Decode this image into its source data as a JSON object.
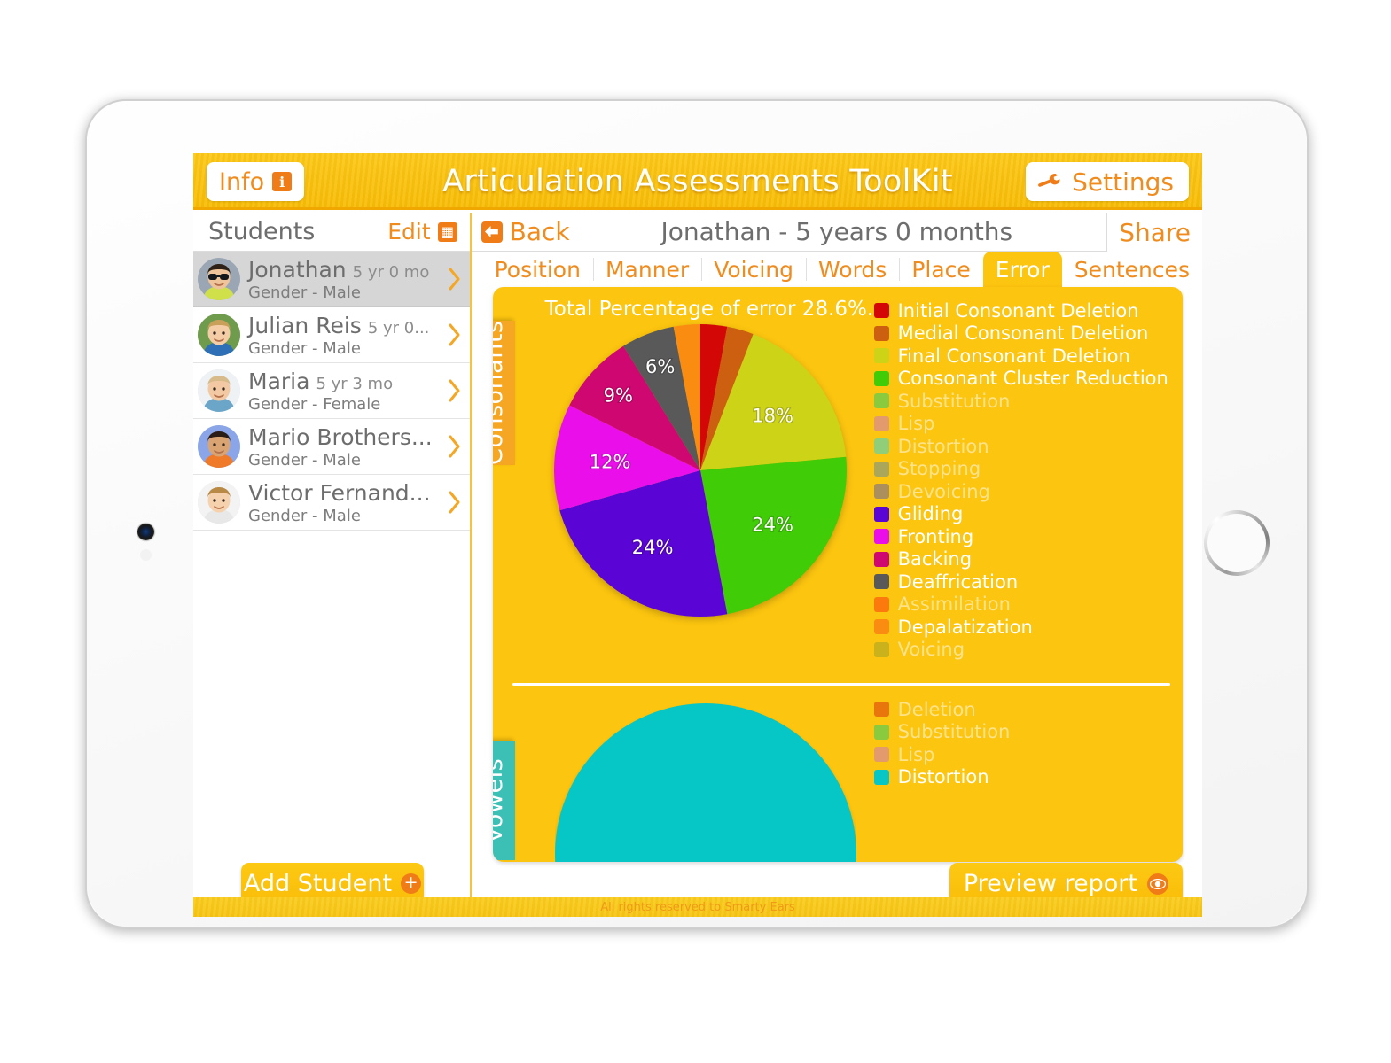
{
  "app": {
    "title": "Articulation Assessments ToolKit",
    "info_label": "Info",
    "info_badge": "i",
    "settings_label": "Settings",
    "footer": "All rights reserved to Smarty Ears",
    "accent_yellow": "#fcc50f",
    "accent_orange": "#f08c1e"
  },
  "sidebar": {
    "title": "Students",
    "edit_label": "Edit",
    "add_student_label": "Add Student",
    "students": [
      {
        "name": "Jonathan",
        "age": "5 yr 0 mo",
        "gender": "Gender - Male",
        "selected": true
      },
      {
        "name": "Julian Reis",
        "age": "5 yr 0...",
        "gender": "Gender - Male",
        "selected": false
      },
      {
        "name": "Maria",
        "age": "5 yr 3 mo",
        "gender": "Gender - Female",
        "selected": false
      },
      {
        "name": "Mario Brothers...",
        "age": "",
        "gender": "Gender - Male",
        "selected": false
      },
      {
        "name": "Victor Fernand...",
        "age": "",
        "gender": "Gender - Male",
        "selected": false
      }
    ]
  },
  "detail": {
    "back_label": "Back",
    "student_title": "Jonathan  - 5 years 0 months",
    "share_label": "Share",
    "preview_label": "Preview report",
    "tabs": [
      {
        "label": "Position",
        "active": false
      },
      {
        "label": "Manner",
        "active": false
      },
      {
        "label": "Voicing",
        "active": false
      },
      {
        "label": "Words",
        "active": false
      },
      {
        "label": "Place",
        "active": false
      },
      {
        "label": "Error",
        "active": true
      },
      {
        "label": "Sentences",
        "active": false
      }
    ],
    "total_percentage": "Total Percentage of error 28.6%.",
    "consonants_tab_label": "Consonants",
    "vowels_tab_label": "Vowels"
  },
  "chart_data": [
    {
      "type": "pie",
      "title": "Consonants",
      "subtitle": "Total Percentage of error 28.6%.",
      "legend_position": "right",
      "categories": [
        "Initial Consonant Deletion",
        "Medial Consonant Deletion",
        "Final Consonant Deletion",
        "Consonant Cluster Reduction",
        "Substitution",
        "Lisp",
        "Distortion",
        "Stopping",
        "Devoicing",
        "Gliding",
        "Fronting",
        "Backing",
        "Deaffrication",
        "Assimilation",
        "Depalatization",
        "Voicing"
      ],
      "values": [
        3,
        3,
        18,
        24,
        0,
        0,
        0,
        0,
        0,
        24,
        12,
        9,
        6,
        0,
        3,
        0
      ],
      "colors": [
        "#d40707",
        "#cc6010",
        "#cdd316",
        "#41cc08",
        "#5ecc51",
        "#d98a92",
        "#66d1a3",
        "#8c9b77",
        "#8c7a7a",
        "#5b04d6",
        "#ea0fea",
        "#cf0770",
        "#595959",
        "#fc5b0c",
        "#fb8c12",
        "#b5ab20"
      ],
      "active": [
        true,
        true,
        true,
        true,
        false,
        false,
        false,
        false,
        false,
        true,
        true,
        true,
        true,
        false,
        true,
        false
      ],
      "slice_labels": [
        "",
        "",
        "18%",
        "24%",
        "",
        "",
        "",
        "",
        "",
        "24%",
        "12%",
        "9%",
        "6%",
        "",
        "",
        ""
      ]
    },
    {
      "type": "pie",
      "title": "Vowels",
      "legend_position": "right",
      "categories": [
        "Deletion",
        "Substitution",
        "Lisp",
        "Distortion"
      ],
      "values": [
        0,
        0,
        0,
        100
      ],
      "colors": [
        "#e2560c",
        "#5ecc51",
        "#d98a92",
        "#06c6c6"
      ],
      "active": [
        false,
        false,
        false,
        true
      ],
      "slice_labels": [
        "",
        "",
        "",
        ""
      ]
    }
  ]
}
